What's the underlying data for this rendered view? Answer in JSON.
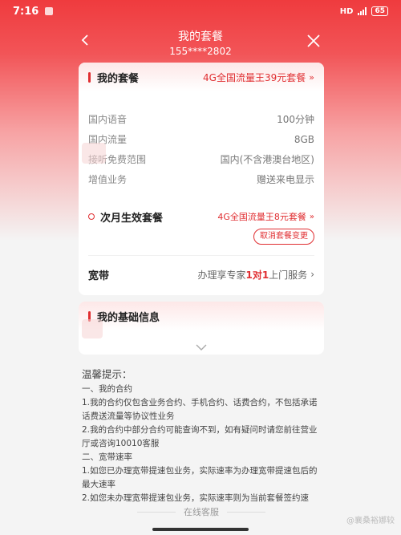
{
  "status_bar": {
    "time": "7:16",
    "battery": "65"
  },
  "nav": {
    "title": "我的套餐",
    "phone": "155****2802"
  },
  "plan": {
    "label": "我的套餐",
    "name": "4G全国流量王39元套餐",
    "rows": [
      {
        "key": "国内语音",
        "value": "100分钟"
      },
      {
        "key": "国内流量",
        "value": "8GB"
      },
      {
        "key": "接听免费范围",
        "value": "国内(不含港澳台地区)"
      },
      {
        "key": "增值业务",
        "value": "赠送来电显示"
      }
    ],
    "next_label": "次月生效套餐",
    "next_name": "4G全国流量王8元套餐",
    "cancel_label": "取消套餐变更",
    "broadband_label": "宽带",
    "broadband_desc_pre": "办理享专家",
    "broadband_desc_em": "1对1",
    "broadband_desc_post": "上门服务"
  },
  "basic": {
    "label": "我的基础信息"
  },
  "tips": {
    "title": "温馨提示：",
    "lines": [
      "一、我的合约",
      "1.我的合约仅包含业务合约、手机合约、话费合约，不包括承诺话费送流量等协议性业务",
      "2.我的合约中部分合约可能查询不到，如有疑问时请您前往营业厅或咨询10010客服",
      "二、宽带速率",
      "1.如您已办理宽带提速包业务，实际速率为办理宽带提速包后的最大速率",
      "2.如您未办理宽带提速包业务，实际速率则为当前套餐签约速"
    ]
  },
  "service_label": "在线客服",
  "watermark_text": "@襄桑裕娜较",
  "icons": {
    "back": "chevron-left-icon",
    "close": "close-icon",
    "expand": "chevron-down-icon"
  },
  "colors": {
    "accent": "#e02e31",
    "hero": "#ef3b3e"
  }
}
